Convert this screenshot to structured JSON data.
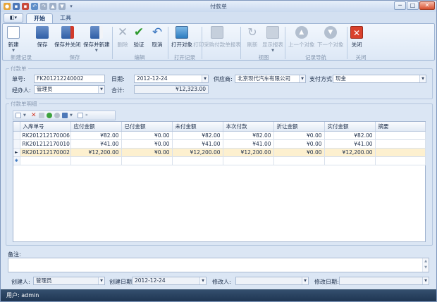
{
  "window": {
    "title": "付款单",
    "minimize": "─",
    "maximize": "□",
    "close": "✕"
  },
  "tabs": [
    {
      "label": "开始"
    },
    {
      "label": "工具"
    }
  ],
  "ribbon": {
    "buttons": [
      {
        "label": "新建",
        "icon": "new-document-icon"
      },
      {
        "label": "保存",
        "icon": "save-icon"
      },
      {
        "label": "保存并关闭",
        "icon": "save-close-icon"
      },
      {
        "label": "保存并新建",
        "icon": "save-new-icon"
      },
      {
        "label": "删除",
        "icon": "delete-x-icon"
      },
      {
        "label": "验证",
        "icon": "checkmark-icon"
      },
      {
        "label": "取消",
        "icon": "undo-icon"
      },
      {
        "label": "打开对象",
        "icon": "open-object-icon"
      },
      {
        "label": "打印采购付款单报表",
        "icon": "printer-icon"
      },
      {
        "label": "刷新",
        "icon": "refresh-icon"
      },
      {
        "label": "显示报表",
        "icon": "report-icon"
      },
      {
        "label": "上一个对象",
        "icon": "up-arrow-icon"
      },
      {
        "label": "下一个对象",
        "icon": "down-arrow-icon"
      },
      {
        "label": "关闭",
        "icon": "close-icon"
      }
    ],
    "groups": [
      {
        "label": "新建记录"
      },
      {
        "label": "保存"
      },
      {
        "label": "编辑"
      },
      {
        "label": "打开记录"
      },
      {
        "label": "视图"
      },
      {
        "label": "记录导航"
      },
      {
        "label": "关闭"
      }
    ]
  },
  "form": {
    "section_title": "付款单",
    "number_label": "单号:",
    "number_value": "FK201212240002",
    "date_label": "日期:",
    "date_value": "2012-12-24",
    "supplier_label": "供应商:",
    "supplier_value": "北京现代汽车有限公司",
    "payment_label": "支付方式:",
    "payment_value": "现金",
    "handler_label": "经办人:",
    "handler_value": "管理员",
    "total_label": "合计:",
    "total_value": "¥12,323.00"
  },
  "details": {
    "section_title": "付款单明细",
    "columns": [
      "入库单号",
      "应付金额",
      "已付金额",
      "未付金额",
      "本次付款",
      "折让金额",
      "实付金额",
      "摘要"
    ],
    "rows": [
      [
        "RK201212170006",
        "¥82.00",
        "¥0.00",
        "¥82.00",
        "¥82.00",
        "¥0.00",
        "¥82.00",
        ""
      ],
      [
        "RK201212170010",
        "¥41.00",
        "¥0.00",
        "¥41.00",
        "¥41.00",
        "¥0.00",
        "¥41.00",
        ""
      ],
      [
        "RK201212170002",
        "¥12,200.00",
        "¥0.00",
        "¥12,200.00",
        "¥12,200.00",
        "¥0.00",
        "¥12,200.00",
        ""
      ]
    ],
    "current_row_marker": "►",
    "new_row_marker": "✱"
  },
  "footer": {
    "remark_label": "备注:",
    "creator_label": "创建人:",
    "creator_value": "管理员",
    "created_date_label": "创建日期:",
    "created_date_value": "2012-12-24",
    "modifier_label": "修改人:",
    "modifier_value": "",
    "modified_date_label": "修改日期:",
    "modified_date_value": ""
  },
  "status": {
    "user": "用户: admin"
  }
}
